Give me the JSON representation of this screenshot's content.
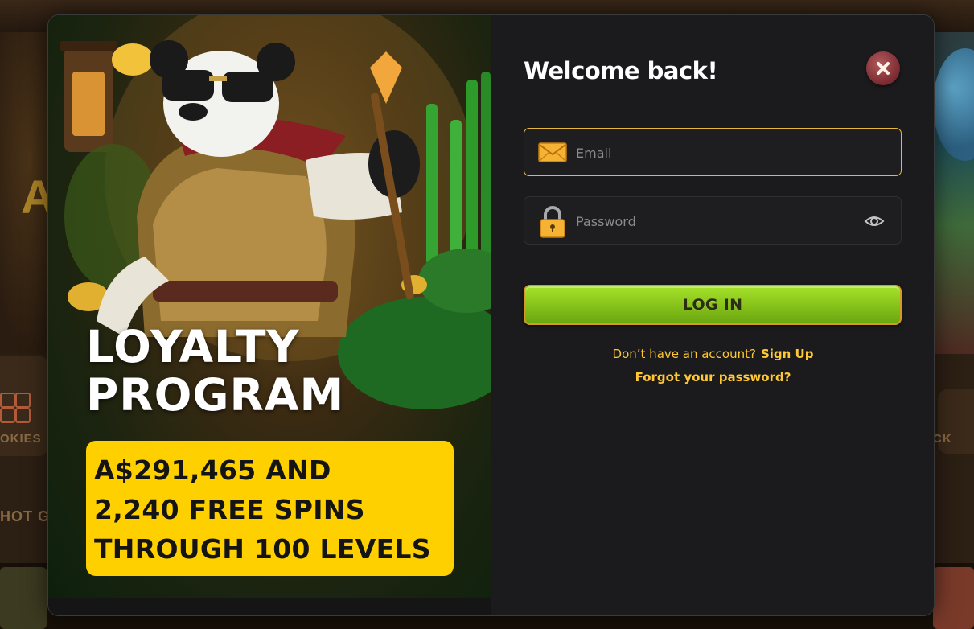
{
  "background": {
    "hero_partial_text": "A",
    "category_left_label": "OKIES",
    "category_right_label": "CK",
    "section_label": "HOT GA"
  },
  "promo": {
    "heading_line1": "LOYALTY",
    "heading_line2": "PROGRAM",
    "offer_line1": "A$291,465 AND",
    "offer_line2": "2,240 FREE SPINS",
    "offer_line3": "THROUGH 100 LEVELS"
  },
  "login": {
    "title": "Welcome back!",
    "email_placeholder": "Email",
    "email_value": "",
    "password_placeholder": "Password",
    "password_value": "",
    "submit_label": "LOG IN",
    "no_account_text": "Don’t have an account?",
    "signup_label": "Sign Up",
    "forgot_label": "Forgot your password?"
  },
  "colors": {
    "accent_yellow": "#ffc834",
    "promo_box": "#ffd000",
    "login_button": "#8cc81c",
    "close_button": "#8a3a40",
    "panel_bg": "#1b1b1d"
  },
  "icons": {
    "close": "close-icon",
    "email": "envelope-icon",
    "password": "lock-icon",
    "toggle_password": "eye-icon"
  }
}
